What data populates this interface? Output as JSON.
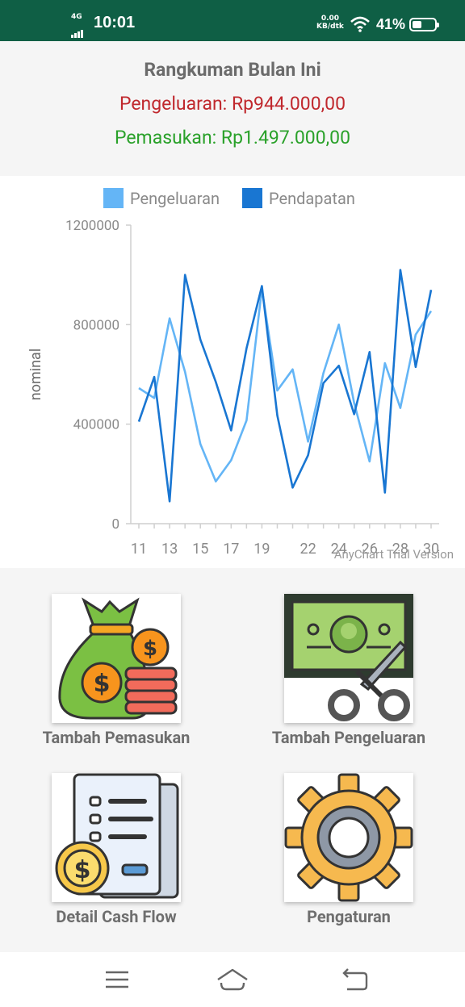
{
  "status_bar": {
    "network": "4G",
    "time": "10:01",
    "speed_value": "0.00",
    "speed_unit": "KB/dtk",
    "battery": "41%"
  },
  "summary": {
    "title": "Rangkuman Bulan Ini",
    "expense": "Pengeluaran: Rp944.000,00",
    "income": "Pemasukan: Rp1.497.000,00"
  },
  "chart_data": {
    "type": "line",
    "ylabel": "nominal",
    "ylim": [
      0,
      1200000
    ],
    "yticks": [
      "1200000",
      "800000",
      "400000",
      "0"
    ],
    "xticks": [
      "11",
      "13",
      "15",
      "17",
      "19",
      "22",
      "24",
      "26",
      "28",
      "30"
    ],
    "watermark": "AnyChart Trial Version",
    "series": [
      {
        "name": "Pengeluaran",
        "color": "#64b5f6",
        "values": [
          545000,
          505000,
          825000,
          610000,
          320000,
          170000,
          255000,
          415000,
          945000,
          535000,
          620000,
          330000,
          605000,
          800000,
          485000,
          250000,
          645000,
          465000,
          760000,
          855000
        ]
      },
      {
        "name": "Pendapatan",
        "color": "#1976d2",
        "values": [
          410000,
          590000,
          90000,
          1000000,
          740000,
          570000,
          375000,
          705000,
          955000,
          435000,
          145000,
          275000,
          565000,
          635000,
          440000,
          690000,
          125000,
          1020000,
          630000,
          940000
        ]
      }
    ]
  },
  "menu": {
    "income_label": "Tambah Pemasukan",
    "expense_label": "Tambah Pengeluaran",
    "cashflow_label": "Detail Cash Flow",
    "settings_label": "Pengaturan"
  },
  "nav": {
    "menu_icon": "menu-icon",
    "home_icon": "home-icon",
    "back_icon": "back-icon"
  }
}
